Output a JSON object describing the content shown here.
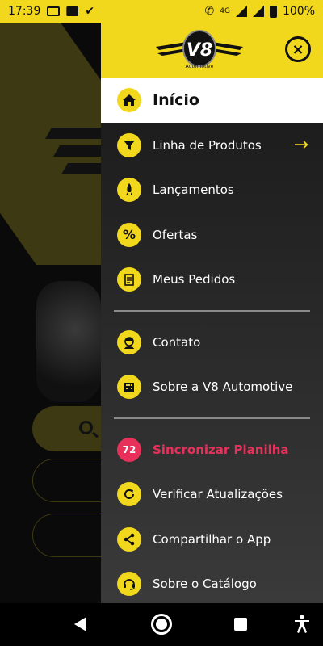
{
  "status_bar": {
    "time": "17:39",
    "signal_label": "4G",
    "battery": "100%"
  },
  "drawer": {
    "logo_text": "V8",
    "logo_subtext": "Automotive",
    "active_item": {
      "label": "Início",
      "icon": "home-icon"
    },
    "items": [
      {
        "label": "Linha de Produtos",
        "icon": "filter-icon",
        "has_arrow": true
      },
      {
        "label": "Lançamentos",
        "icon": "rocket-icon"
      },
      {
        "label": "Ofertas",
        "icon": "percent-icon"
      },
      {
        "label": "Meus Pedidos",
        "icon": "clipboard-icon"
      }
    ],
    "items2": [
      {
        "label": "Contato",
        "icon": "person-icon"
      },
      {
        "label": "Sobre a V8 Automotive",
        "icon": "building-icon"
      }
    ],
    "items3": [
      {
        "label": "Sincronizar Planilha",
        "badge": "72",
        "accent": "#e8315a"
      },
      {
        "label": "Verificar Atualizações",
        "icon": "refresh-icon"
      },
      {
        "label": "Compartilhar o App",
        "icon": "share-icon"
      },
      {
        "label": "Sobre o Catálogo",
        "icon": "support-icon"
      }
    ],
    "arrow_glyph": "→",
    "close_glyph": "×"
  },
  "colors": {
    "brand_yellow": "#f2d81d",
    "sync_red": "#e8315a"
  }
}
